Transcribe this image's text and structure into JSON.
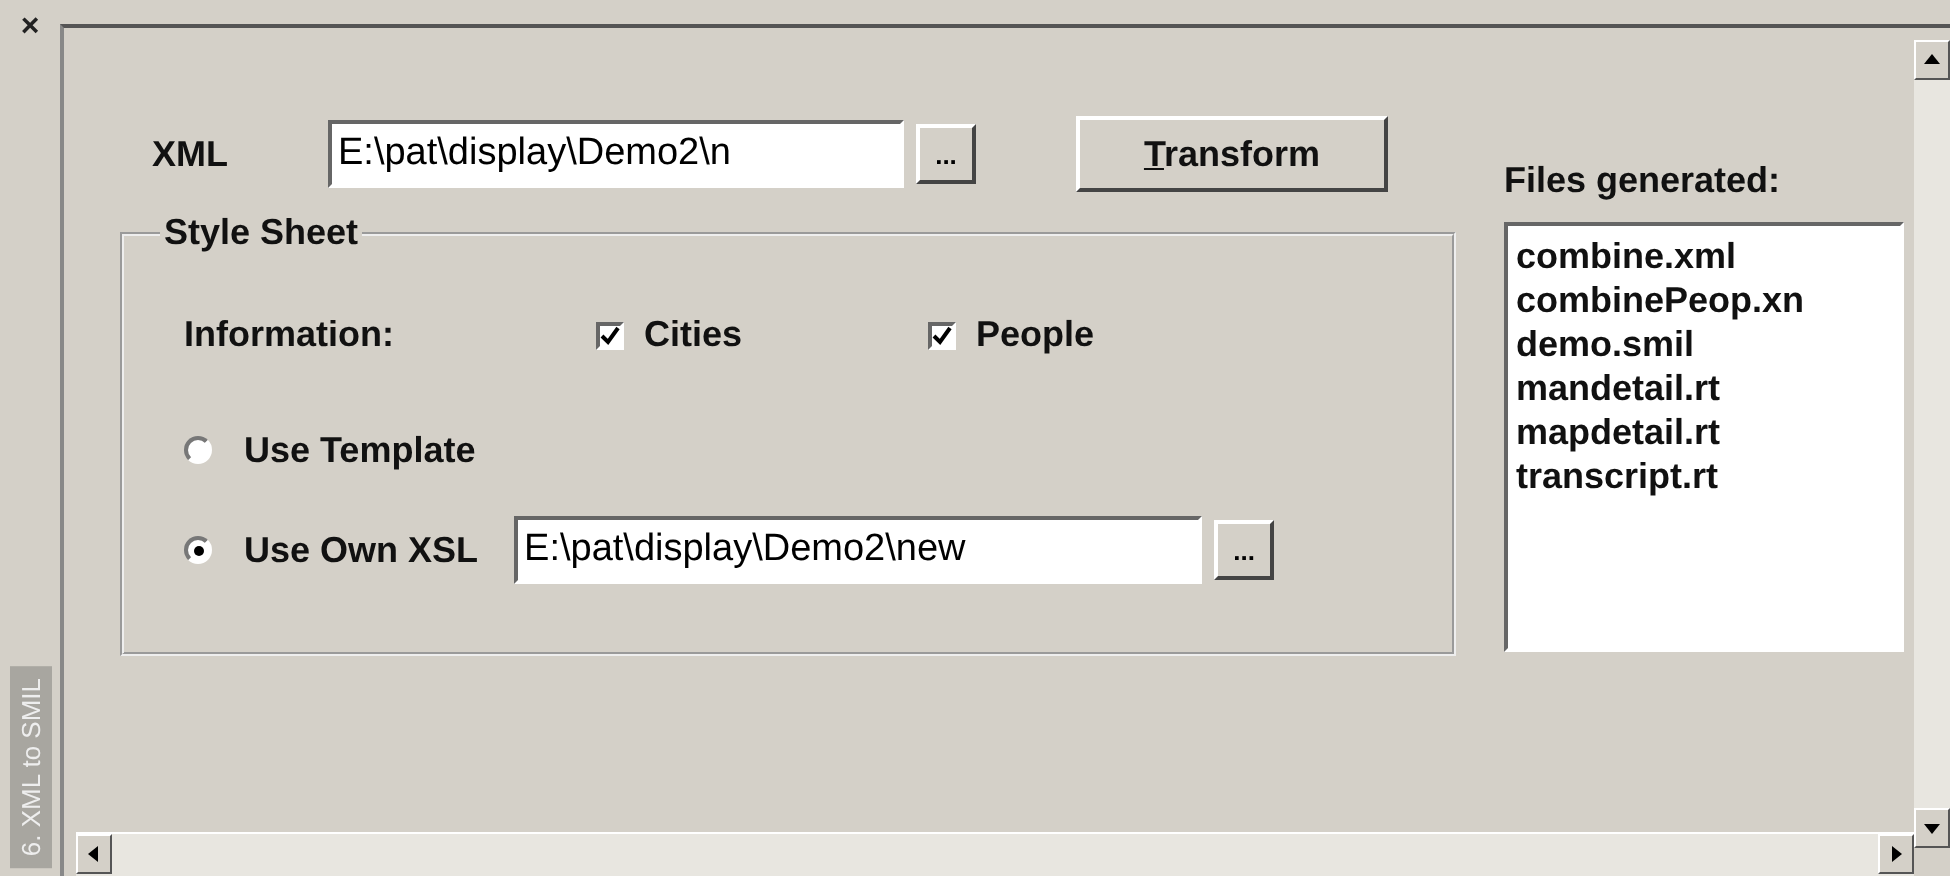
{
  "side_tab": {
    "close": "×",
    "label": "6. XML to SMIL"
  },
  "xml": {
    "label": "XML",
    "value": "E:\\pat\\display\\Demo2\\n",
    "browse": "..."
  },
  "transform": {
    "label": "Transform",
    "mnemonic": true
  },
  "style_sheet": {
    "title": "Style Sheet",
    "information_label": "Information:",
    "checkboxes": [
      {
        "label": "Cities",
        "checked": true
      },
      {
        "label": "People",
        "checked": true
      }
    ],
    "options": [
      {
        "kind": "plain",
        "label": "Use Template",
        "selected": false
      },
      {
        "kind": "file",
        "label": "Use Own XSL",
        "selected": true,
        "value": "E:\\pat\\display\\Demo2\\new",
        "browse": "..."
      }
    ]
  },
  "files": {
    "label": "Files generated:",
    "items": [
      "combine.xml",
      "combinePeop.xn",
      "demo.smil",
      "mandetail.rt",
      "mapdetail.rt",
      "transcript.rt"
    ]
  }
}
